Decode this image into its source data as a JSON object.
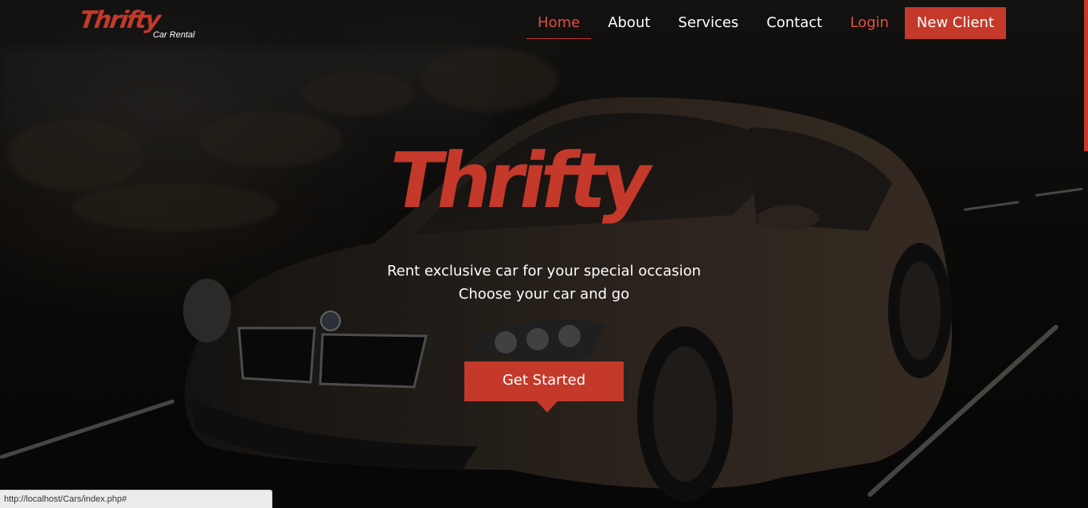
{
  "brand": {
    "logo_word": "Thrifty",
    "logo_sub": "Car Rental",
    "accent": "#c4392a"
  },
  "nav": {
    "items": [
      {
        "label": "Home",
        "active": true
      },
      {
        "label": "About"
      },
      {
        "label": "Services"
      },
      {
        "label": "Contact"
      },
      {
        "label": "Login"
      },
      {
        "label": "New Client"
      }
    ]
  },
  "hero": {
    "logo_word": "Thrifty",
    "line1": "Rent exclusive car for your special occasion",
    "line2": "Choose your car and go",
    "cta": "Get Started"
  },
  "status_bar": {
    "url": "http://localhost/Cars/index.php#"
  }
}
